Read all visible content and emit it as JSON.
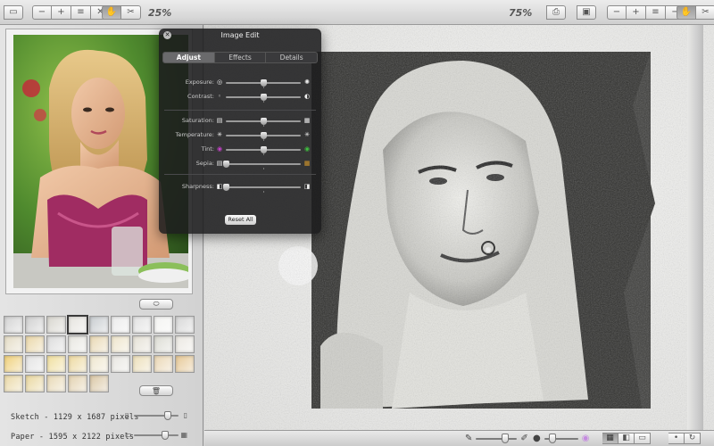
{
  "toolbar": {
    "left_zoom": "25%",
    "right_zoom": "75%",
    "left_buttons": [
      {
        "icon": "folder-icon",
        "glyph": "▭"
      },
      {
        "icon": "zoom-in-icon",
        "glyph": "+"
      },
      {
        "icon": "fit-icon",
        "glyph": "≡"
      },
      {
        "icon": "zoom-out-icon",
        "glyph": "−"
      },
      {
        "icon": "hand-icon",
        "glyph": "✋"
      },
      {
        "icon": "crop-icon",
        "glyph": "✂"
      }
    ],
    "right_buttons": [
      {
        "icon": "print-icon",
        "glyph": "⎙"
      },
      {
        "icon": "save-icon",
        "glyph": "▣"
      },
      {
        "icon": "zoom-out-icon",
        "glyph": "−"
      },
      {
        "icon": "zoom-in-icon",
        "glyph": "+"
      },
      {
        "icon": "fit-icon",
        "glyph": "≡"
      },
      {
        "icon": "zoom-out-icon",
        "glyph": "−"
      },
      {
        "icon": "hand-icon",
        "glyph": "✋"
      },
      {
        "icon": "crop-icon",
        "glyph": "✂"
      }
    ]
  },
  "left_panel": {
    "sketch_info": "Sketch - 1129 x 1687 pixels",
    "paper_info": "Paper - 1595 x 2122 pixels",
    "sketch_slider_value": 0.75,
    "paper_slider_value": 0.7,
    "papers": [
      "#d3d3d3",
      "#cfcfcf",
      "#d8d6cf",
      "#e6e4df",
      "#c9cdd0",
      "#ececec",
      "#e2e2e2",
      "#f4f4f2",
      "#d7d7d7",
      "#e4dcc6",
      "#ead7a9",
      "#dcdcdc",
      "#e8e7e1",
      "#e9d9b5",
      "#eee5cc",
      "#e5e1d6",
      "#dcdcd4",
      "#ebe8e2",
      "#efd07b",
      "#e3e3e3",
      "#f0df9f",
      "#edd9a1",
      "#efe7cf",
      "#e8e6e1",
      "#ecdfba",
      "#ead7b5",
      "#e6c896",
      "#ead9a8",
      "#e9d7a0",
      "#e8d9b6",
      "#e3d2b1",
      "#dbc8a7"
    ],
    "selected_paper": 3
  },
  "hud": {
    "title": "Image Edit",
    "tabs": [
      "Adjust",
      "Effects",
      "Details"
    ],
    "active_tab": 0,
    "sliders": [
      {
        "label": "Exposure:",
        "value": 0.5,
        "left_icon": "◎",
        "right_icon": "✺"
      },
      {
        "label": "Contrast:",
        "value": 0.5,
        "left_icon": "◦",
        "right_icon": "◐"
      },
      {
        "label": "Saturation:",
        "value": 0.5,
        "left_icon": "▤",
        "right_icon": "▦"
      },
      {
        "label": "Temperature:",
        "value": 0.5,
        "left_icon": "✳",
        "right_icon": "✳"
      },
      {
        "label": "Tint:",
        "value": 0.5,
        "left_icon": "◉",
        "right_icon": "◉"
      },
      {
        "label": "Sepia:",
        "value": 0.0,
        "left_icon": "▤",
        "right_icon": "▦"
      },
      {
        "label": "Sharpness:",
        "value": 0.0,
        "left_icon": "◧",
        "right_icon": "◨"
      }
    ],
    "reset_label": "Reset All"
  },
  "colors": {
    "tint_left": "#c341c7",
    "tint_right": "#3fbf3f",
    "sepia_right": "#d79a2a"
  }
}
